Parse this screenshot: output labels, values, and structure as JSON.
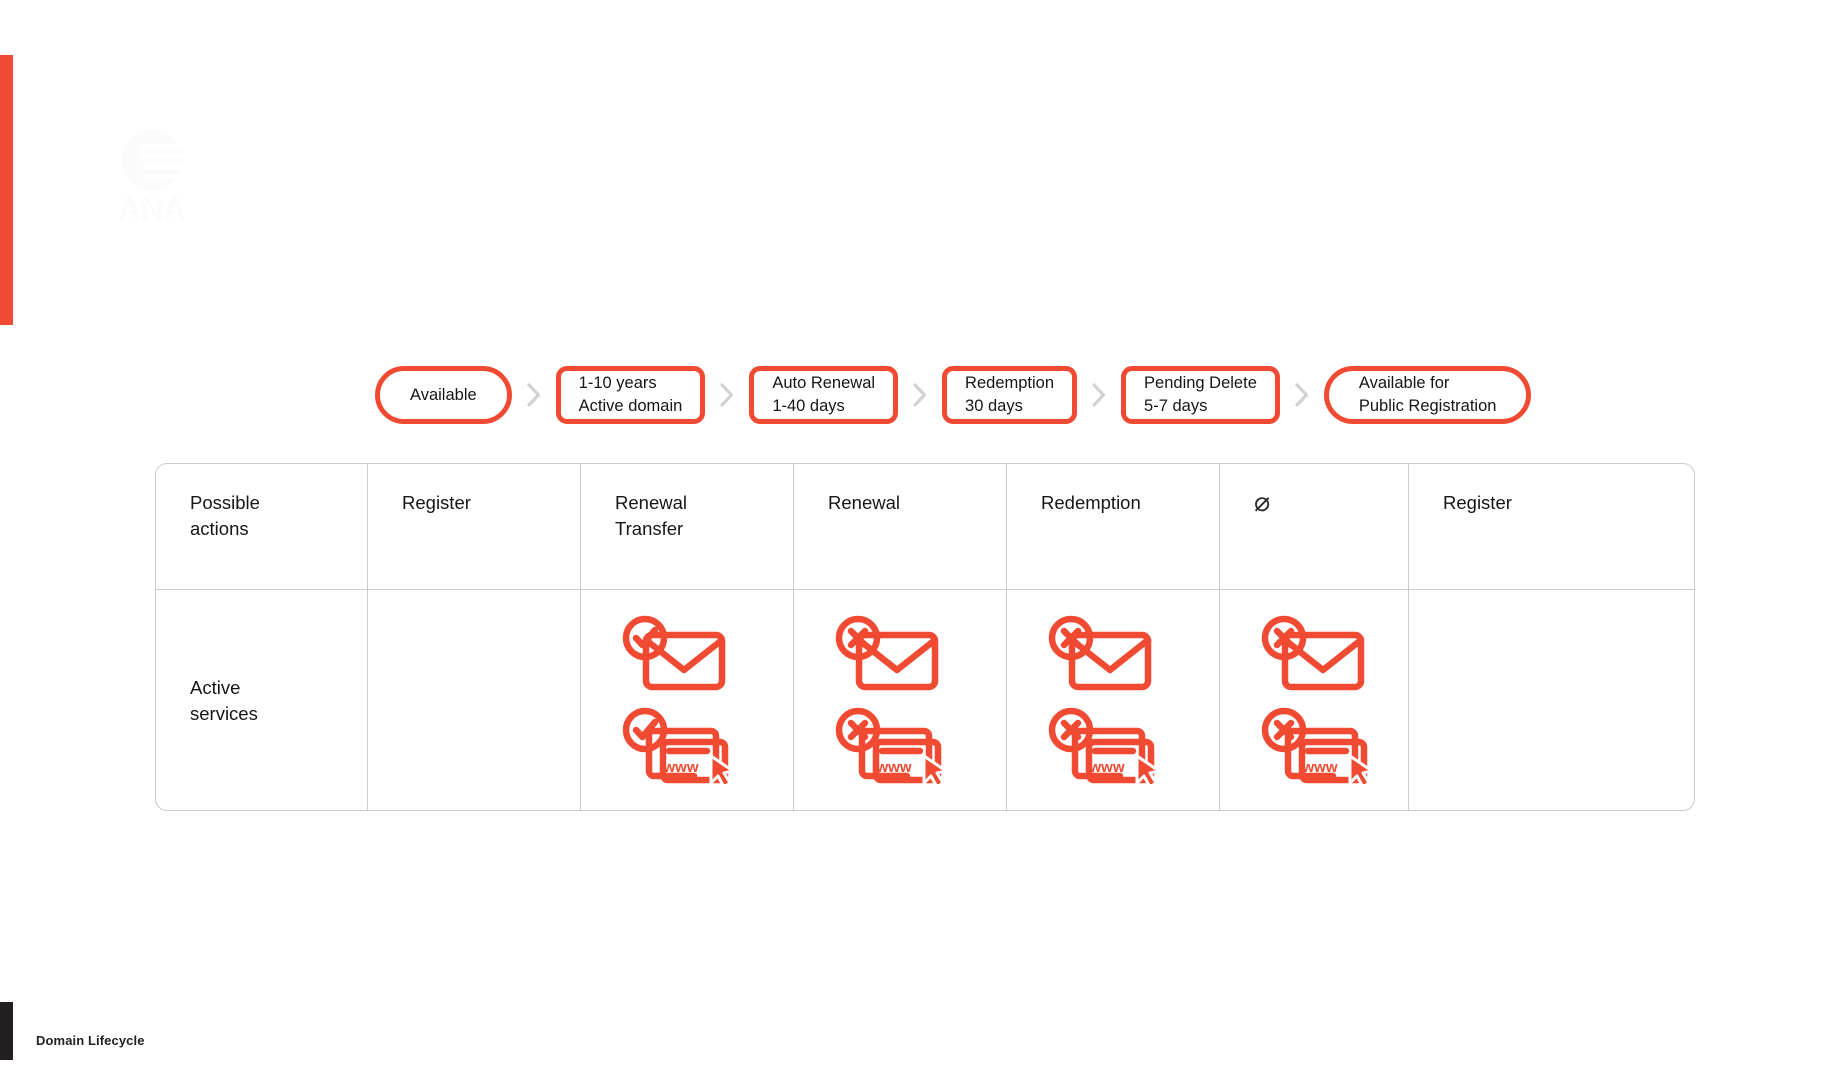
{
  "theme": {
    "accent": "#F04B32",
    "ink": "#161616",
    "rule": "#c9ccce",
    "chevron": "#d2d2d2",
    "footer_bar": "#231f20"
  },
  "footer": {
    "label": "Domain Lifecycle",
    "bar_name": "footer-accent-bar"
  },
  "watermark": {
    "name": "company-logo-watermark",
    "wordmark": "ANA"
  },
  "flow": {
    "name": "domain-lifecycle-flow",
    "separator_glyph": "›",
    "stages": [
      {
        "id": "available",
        "shape": "capsule",
        "text": "Available"
      },
      {
        "id": "active",
        "shape": "rect",
        "text": "1-10 years\nActive domain"
      },
      {
        "id": "auto-renewal",
        "shape": "rect",
        "text": "Auto Renewal\n1-40 days"
      },
      {
        "id": "redemption",
        "shape": "rect",
        "text": "Redemption\n30 days"
      },
      {
        "id": "pending",
        "shape": "rect",
        "text": "Pending Delete\n5-7 days"
      },
      {
        "id": "public-reg",
        "shape": "capsule",
        "text": "Available for\nPublic Registration"
      }
    ]
  },
  "table": {
    "name": "lifecycle-matrix",
    "rows": [
      {
        "id": "possible-actions",
        "label": "Possible\nactions",
        "cells": [
          {
            "id": "available",
            "text": "Register"
          },
          {
            "id": "active",
            "text": "Renewal\nTransfer"
          },
          {
            "id": "auto-renewal",
            "text": "Renewal"
          },
          {
            "id": "redemption",
            "text": "Redemption"
          },
          {
            "id": "pending",
            "text": "⌀",
            "symbol": "empty-set"
          },
          {
            "id": "public-reg",
            "text": "Register"
          }
        ]
      },
      {
        "id": "active-services",
        "label": "Active\nservices",
        "cells": [
          {
            "id": "available",
            "icons": []
          },
          {
            "id": "active",
            "icons": [
              "mail-check",
              "web-check"
            ]
          },
          {
            "id": "auto-renewal",
            "icons": [
              "mail-cross",
              "web-cross"
            ]
          },
          {
            "id": "redemption",
            "icons": [
              "mail-cross",
              "web-cross"
            ]
          },
          {
            "id": "pending",
            "icons": [
              "mail-cross",
              "web-cross"
            ]
          },
          {
            "id": "public-reg",
            "icons": []
          }
        ]
      }
    ],
    "icon_label": "www"
  }
}
